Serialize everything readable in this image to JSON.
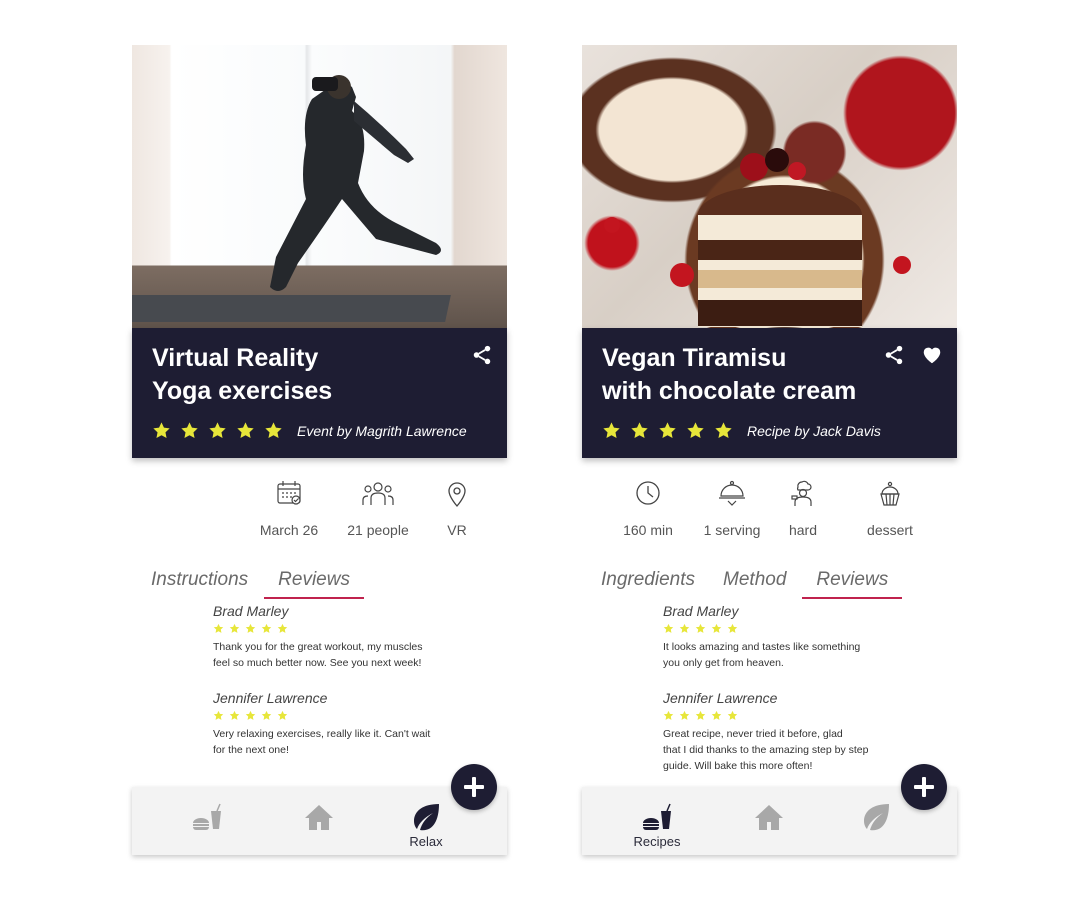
{
  "colors": {
    "navy": "#1e1d33",
    "star": "#e7e63a",
    "accent": "#c0234e",
    "nav_inactive": "#a8a8a8"
  },
  "left": {
    "card": {
      "title_line1": "Virtual Reality",
      "title_line2": "Yoga exercises",
      "byline": "Event by Magrith Lawrence",
      "rating": 5,
      "actions": [
        "share-icon"
      ]
    },
    "info": [
      {
        "icon": "calendar-icon",
        "label": "March 26"
      },
      {
        "icon": "people-icon",
        "label": "21 people"
      },
      {
        "icon": "location-pin-icon",
        "label": "VR"
      }
    ],
    "tabs": [
      {
        "label": "Instructions",
        "active": false
      },
      {
        "label": "Reviews",
        "active": true
      }
    ],
    "reviews": [
      {
        "name": "Brad Marley",
        "rating": 5,
        "text_line1": "Thank you for the great workout, my muscles",
        "text_line2": "feel so much better now. See you next week!"
      },
      {
        "name": "Jennifer Lawrence",
        "rating": 5,
        "text_line1": "Very relaxing exercises, really like it. Can't wait",
        "text_line2": "for the next one!"
      }
    ],
    "nav": [
      {
        "icon": "food-drink-icon",
        "label": "",
        "active": false
      },
      {
        "icon": "home-icon",
        "label": "",
        "active": false
      },
      {
        "icon": "leaf-icon",
        "label": "Relax",
        "active": true
      }
    ],
    "fab_icon": "plus-icon"
  },
  "right": {
    "card": {
      "title_line1": "Vegan Tiramisu",
      "title_line2": "with chocolate cream",
      "byline": "Recipe by Jack Davis",
      "rating": 5,
      "actions": [
        "share-icon",
        "heart-icon"
      ]
    },
    "info": [
      {
        "icon": "clock-icon",
        "label": "160 min"
      },
      {
        "icon": "serving-cloche-icon",
        "label": "1 serving"
      },
      {
        "icon": "chef-icon",
        "label": "hard"
      },
      {
        "icon": "cupcake-icon",
        "label": "dessert"
      }
    ],
    "tabs": [
      {
        "label": "Ingredients",
        "active": false
      },
      {
        "label": "Method",
        "active": false
      },
      {
        "label": "Reviews",
        "active": true
      }
    ],
    "reviews": [
      {
        "name": "Brad Marley",
        "rating": 5,
        "text_line1": "It looks amazing and tastes like something",
        "text_line2": "you only get from heaven."
      },
      {
        "name": "Jennifer Lawrence",
        "rating": 5,
        "text_line1": "Great recipe, never tried it before, glad",
        "text_line2": "that I did thanks to the amazing step by step",
        "text_line3": "guide. Will bake this more often!"
      }
    ],
    "nav": [
      {
        "icon": "food-drink-icon",
        "label": "Recipes",
        "active": true
      },
      {
        "icon": "home-icon",
        "label": "",
        "active": false
      },
      {
        "icon": "leaf-icon",
        "label": "",
        "active": false
      }
    ],
    "fab_icon": "plus-icon"
  }
}
